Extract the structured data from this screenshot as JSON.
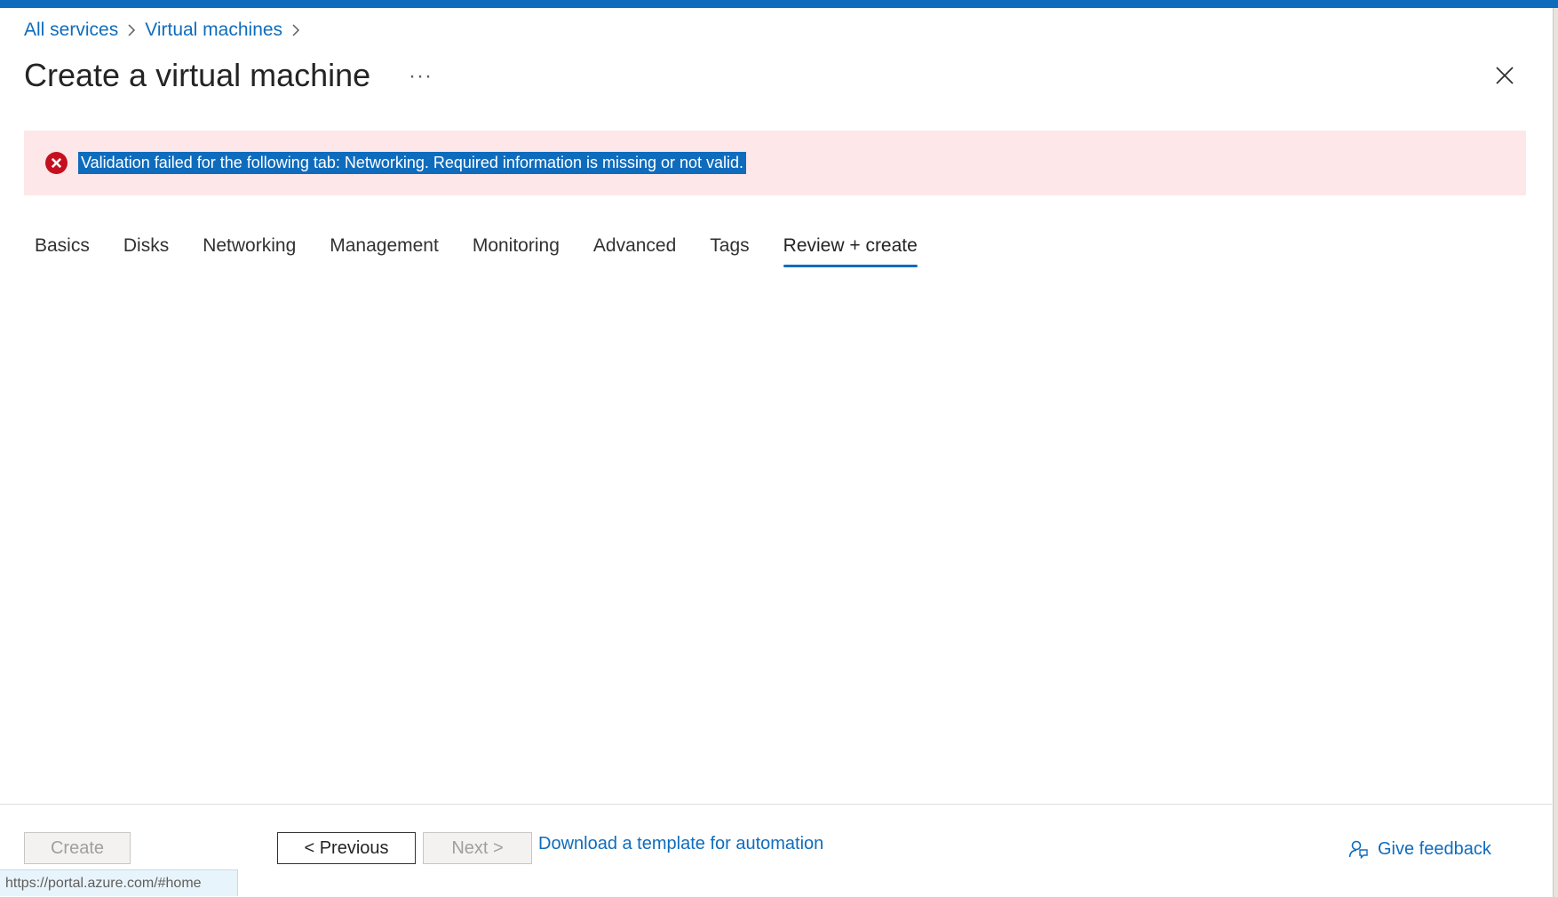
{
  "breadcrumb": {
    "items": [
      "All services",
      "Virtual machines"
    ]
  },
  "page": {
    "title": "Create a virtual machine",
    "more_label": "···"
  },
  "banner": {
    "message": "Validation failed for the following tab: Networking. Required information is missing or not valid."
  },
  "tabs": [
    {
      "label": "Basics",
      "active": false
    },
    {
      "label": "Disks",
      "active": false
    },
    {
      "label": "Networking",
      "active": false
    },
    {
      "label": "Management",
      "active": false
    },
    {
      "label": "Monitoring",
      "active": false
    },
    {
      "label": "Advanced",
      "active": false
    },
    {
      "label": "Tags",
      "active": false
    },
    {
      "label": "Review + create",
      "active": true
    }
  ],
  "footer": {
    "create_label": "Create",
    "previous_label": "< Previous",
    "next_label": "Next >",
    "download_label": "Download a template for automation",
    "feedback_label": "Give feedback"
  },
  "status": {
    "url": "https://portal.azure.com/#home"
  },
  "colors": {
    "accent": "#0f6cbd",
    "error": "#c50f1f",
    "banner_bg": "#fde7e9"
  }
}
